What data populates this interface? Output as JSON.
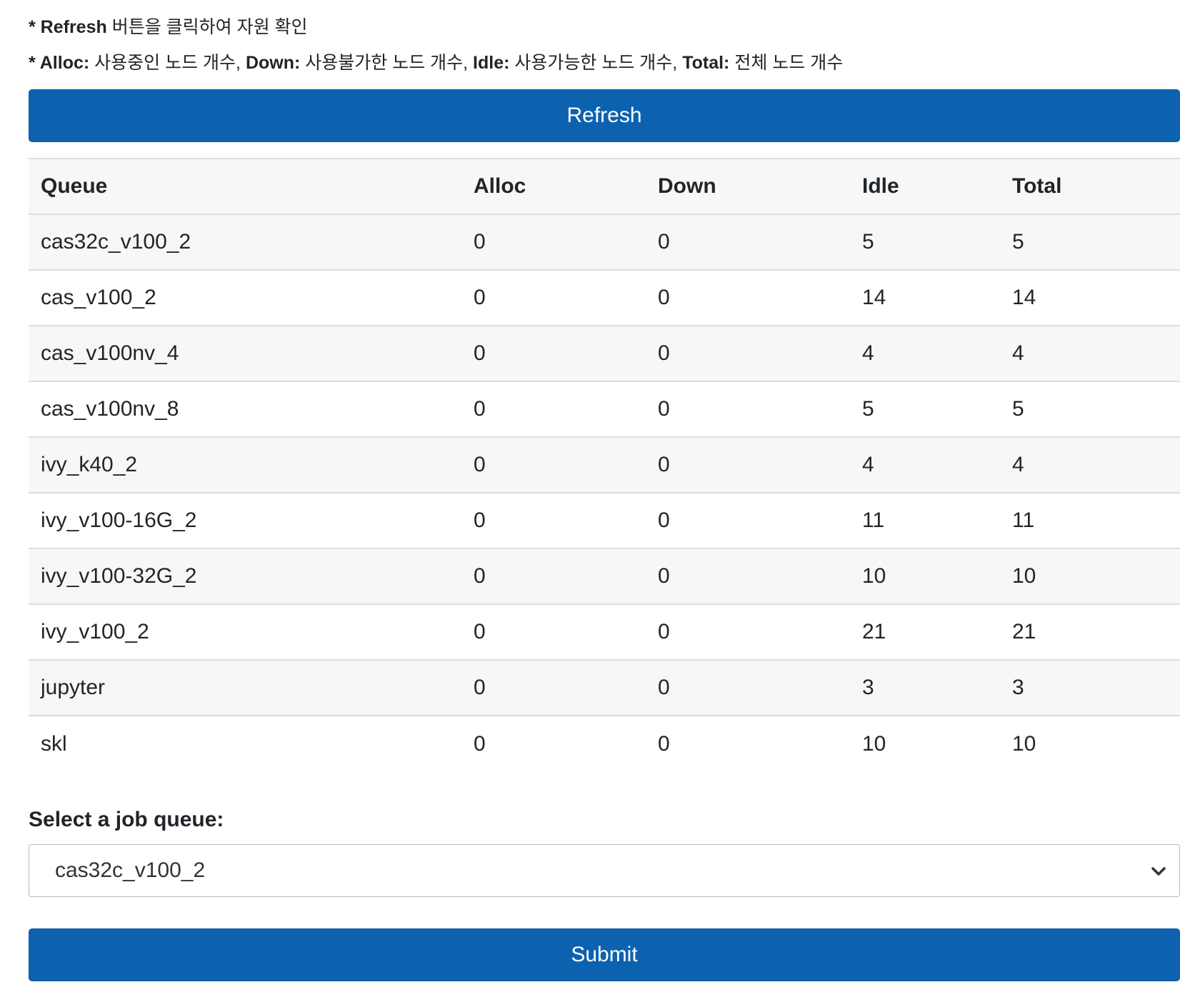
{
  "notes": {
    "line1": {
      "bold": "* Refresh",
      "text": " 버튼을 클릭하여 자원 확인"
    },
    "line2": [
      {
        "bold": "* Alloc:",
        "text": " 사용중인 노드 개수, "
      },
      {
        "bold": "Down:",
        "text": " 사용불가한 노드 개수, "
      },
      {
        "bold": "Idle:",
        "text": " 사용가능한 노드 개수, "
      },
      {
        "bold": "Total:",
        "text": " 전체 노드 개수"
      }
    ]
  },
  "refresh_button": {
    "label": "Refresh"
  },
  "table": {
    "headers": [
      "Queue",
      "Alloc",
      "Down",
      "Idle",
      "Total"
    ],
    "rows": [
      [
        "cas32c_v100_2",
        "0",
        "0",
        "5",
        "5"
      ],
      [
        "cas_v100_2",
        "0",
        "0",
        "14",
        "14"
      ],
      [
        "cas_v100nv_4",
        "0",
        "0",
        "4",
        "4"
      ],
      [
        "cas_v100nv_8",
        "0",
        "0",
        "5",
        "5"
      ],
      [
        "ivy_k40_2",
        "0",
        "0",
        "4",
        "4"
      ],
      [
        "ivy_v100-16G_2",
        "0",
        "0",
        "11",
        "11"
      ],
      [
        "ivy_v100-32G_2",
        "0",
        "0",
        "10",
        "10"
      ],
      [
        "ivy_v100_2",
        "0",
        "0",
        "21",
        "21"
      ],
      [
        "jupyter",
        "0",
        "0",
        "3",
        "3"
      ],
      [
        "skl",
        "0",
        "0",
        "10",
        "10"
      ]
    ]
  },
  "queue_select": {
    "label": "Select a job queue:",
    "selected": "cas32c_v100_2",
    "icon": "chevron-down-icon"
  },
  "submit_button": {
    "label": "Submit"
  },
  "colors": {
    "button_blue": "#0d62b0",
    "stripe_gray": "#f7f7f7",
    "border_gray": "#dddddd"
  }
}
